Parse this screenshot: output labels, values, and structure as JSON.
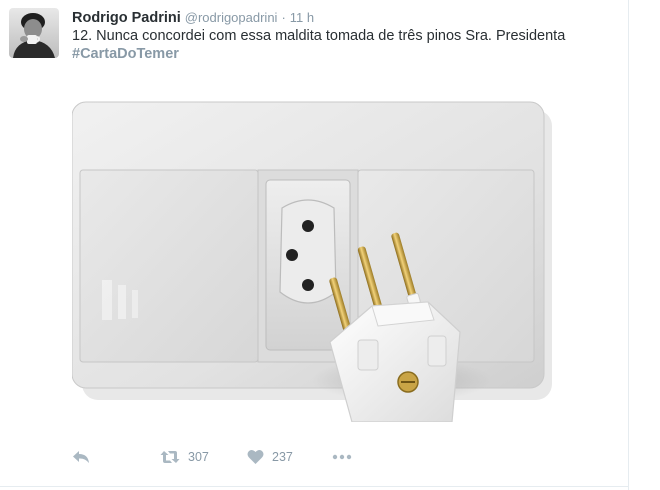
{
  "tweet": {
    "author": {
      "fullname": "Rodrigo Padrini",
      "username": "@rodrigopadrini",
      "separator": "·",
      "timestamp": "11 h"
    },
    "text": "12. Nunca concordei com essa maldita tomada de três pinos Sra. Presidenta",
    "hashtag": "#CartaDoTemer",
    "media": {
      "description_icon": "photo-electrical-outlet-and-three-pin-plug"
    },
    "actions": {
      "reply_icon": "reply-icon",
      "retweet_icon": "retweet-icon",
      "retweet_count": "307",
      "like_icon": "heart-icon",
      "like_count": "237",
      "more_icon": "more-icon"
    }
  },
  "colors": {
    "name": "#292f33",
    "meta": "#8899a6",
    "hashtag": "#8899a6",
    "action_icons": "#aab8c2",
    "divider": "#e6ecf0"
  }
}
